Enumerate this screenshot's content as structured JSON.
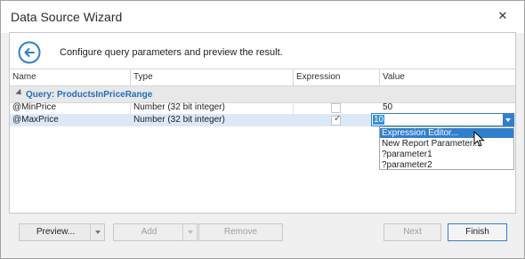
{
  "window": {
    "title": "Data Source Wizard"
  },
  "header": {
    "description": "Configure query parameters and preview the result."
  },
  "grid": {
    "columns": [
      "Name",
      "Type",
      "Expression",
      "Value"
    ],
    "group_title": "Query: ProductsInPriceRange",
    "rows": [
      {
        "name": "@MinPrice",
        "type": "Number (32 bit integer)",
        "expression": false,
        "value": "50"
      },
      {
        "name": "@MaxPrice",
        "type": "Number (32 bit integer)",
        "expression": true,
        "value": "10"
      }
    ],
    "selected_row": 1
  },
  "value_editor": {
    "value": "10"
  },
  "dropdown": {
    "items": [
      "Expression Editor...",
      "New Report Parameter...",
      "?parameter1",
      "?parameter2"
    ],
    "highlighted": 0
  },
  "footer": {
    "preview_label": "Preview...",
    "add_label": "Add",
    "remove_label": "Remove",
    "next_label": "Next",
    "finish_label": "Finish"
  },
  "colors": {
    "accent": "#2f7fd1",
    "selection": "#dbe9f7",
    "group_title": "#1f6fbf"
  }
}
